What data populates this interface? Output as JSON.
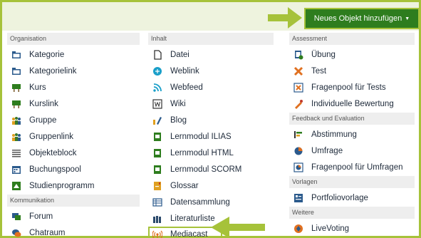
{
  "toolbar": {
    "add_label": "Neues Objekt hinzufügen"
  },
  "columns": [
    {
      "groups": [
        {
          "title": "Organisation",
          "items": [
            {
              "label": "Kategorie",
              "icon": "folder-icon"
            },
            {
              "label": "Kategorielink",
              "icon": "folder-link-icon"
            },
            {
              "label": "Kurs",
              "icon": "course-icon"
            },
            {
              "label": "Kurslink",
              "icon": "course-link-icon"
            },
            {
              "label": "Gruppe",
              "icon": "group-icon"
            },
            {
              "label": "Gruppenlink",
              "icon": "group-link-icon"
            },
            {
              "label": "Objekteblock",
              "icon": "item-group-icon"
            },
            {
              "label": "Buchungspool",
              "icon": "calendar-icon"
            },
            {
              "label": "Studienprogramm",
              "icon": "study-programme-icon"
            }
          ]
        },
        {
          "title": "Kommunikation",
          "items": [
            {
              "label": "Forum",
              "icon": "forum-icon"
            },
            {
              "label": "Chatraum",
              "icon": "chat-icon"
            }
          ]
        }
      ]
    },
    {
      "groups": [
        {
          "title": "Inhalt",
          "items": [
            {
              "label": "Datei",
              "icon": "file-icon"
            },
            {
              "label": "Weblink",
              "icon": "weblink-icon"
            },
            {
              "label": "Webfeed",
              "icon": "rss-icon"
            },
            {
              "label": "Wiki",
              "icon": "wiki-icon"
            },
            {
              "label": "Blog",
              "icon": "blog-icon"
            },
            {
              "label": "Lernmodul ILIAS",
              "icon": "learning-module-icon"
            },
            {
              "label": "Lernmodul HTML",
              "icon": "learning-module-html-icon"
            },
            {
              "label": "Lernmodul SCORM",
              "icon": "learning-module-scorm-icon"
            },
            {
              "label": "Glossar",
              "icon": "glossary-icon"
            },
            {
              "label": "Datensammlung",
              "icon": "data-collection-icon"
            },
            {
              "label": "Literaturliste",
              "icon": "bibliography-icon"
            },
            {
              "label": "Mediacast",
              "icon": "mediacast-icon"
            }
          ]
        }
      ]
    },
    {
      "groups": [
        {
          "title": "Assessment",
          "items": [
            {
              "label": "Übung",
              "icon": "exercise-icon"
            },
            {
              "label": "Test",
              "icon": "test-icon"
            },
            {
              "label": "Fragenpool für Tests",
              "icon": "question-pool-icon"
            },
            {
              "label": "Individuelle Bewertung",
              "icon": "individual-assessment-icon"
            }
          ]
        },
        {
          "title": "Feedback und Evaluation",
          "items": [
            {
              "label": "Abstimmung",
              "icon": "poll-icon"
            },
            {
              "label": "Umfrage",
              "icon": "survey-icon"
            },
            {
              "label": "Fragenpool für Umfragen",
              "icon": "survey-pool-icon"
            }
          ]
        },
        {
          "title": "Vorlagen",
          "items": [
            {
              "label": "Portfoliovorlage",
              "icon": "portfolio-template-icon"
            }
          ]
        },
        {
          "title": "Weitere",
          "items": [
            {
              "label": "LiveVoting",
              "icon": "livevoting-icon"
            }
          ]
        }
      ]
    }
  ],
  "colors": {
    "accent": "#a6c23a",
    "button": "#2e7d1e",
    "topbar": "#eef3de"
  }
}
